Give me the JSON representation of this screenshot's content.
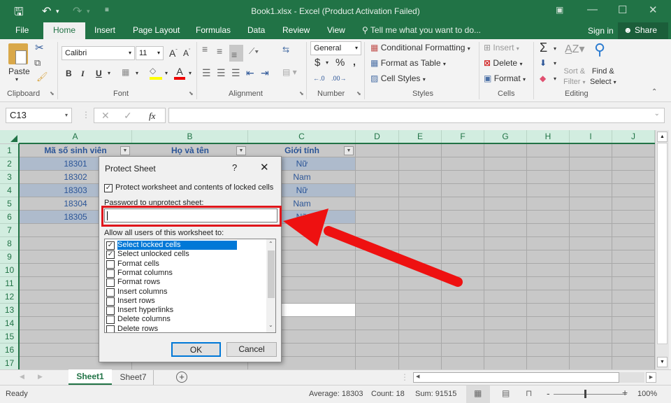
{
  "window": {
    "title": "Book1.xlsx - Excel (Product Activation Failed)"
  },
  "quick_access": {
    "save": "save-icon",
    "undo": "undo-icon",
    "redo": "redo-icon",
    "customize": "customize-icon"
  },
  "tabs": [
    "File",
    "Home",
    "Insert",
    "Page Layout",
    "Formulas",
    "Data",
    "Review",
    "View"
  ],
  "active_tab": "Home",
  "tell_me": "Tell me what you want to do...",
  "sign_in": "Sign in",
  "share": "Share",
  "ribbon": {
    "clipboard": {
      "paste": "Paste",
      "label": "Clipboard"
    },
    "font": {
      "name": "Calibri",
      "size": "11",
      "bold": "B",
      "italic": "I",
      "underline": "U",
      "label": "Font"
    },
    "alignment": {
      "label": "Alignment"
    },
    "number": {
      "format": "General",
      "currency": "$",
      "percent": "%",
      "comma": ",",
      "label": "Number"
    },
    "styles": {
      "conditional": "Conditional Formatting",
      "table": "Format as Table",
      "cell": "Cell Styles",
      "label": "Styles"
    },
    "cells": {
      "insert": "Insert",
      "delete": "Delete",
      "format": "Format",
      "label": "Cells"
    },
    "editing": {
      "sort1": "Sort &",
      "sort2": "Filter",
      "find1": "Find &",
      "find2": "Select",
      "label": "Editing"
    }
  },
  "formula_bar": {
    "name_box": "C13",
    "value": "",
    "fx": "fx"
  },
  "columns": [
    "A",
    "B",
    "C",
    "D",
    "E",
    "F",
    "G",
    "H",
    "I",
    "J"
  ],
  "rows": [
    "1",
    "2",
    "3",
    "4",
    "5",
    "6",
    "7",
    "8",
    "9",
    "10",
    "11",
    "12",
    "13",
    "14",
    "15",
    "16",
    "17"
  ],
  "table": {
    "headers": [
      "Mã số sinh viên",
      "Họ và tên",
      "Giới tính"
    ],
    "rows": [
      [
        "18301",
        "",
        "Nữ"
      ],
      [
        "18302",
        "",
        "Nam"
      ],
      [
        "18303",
        "",
        "Nữ"
      ],
      [
        "18304",
        "",
        "Nam"
      ],
      [
        "18305",
        "",
        "Nữ"
      ]
    ]
  },
  "dialog": {
    "title": "Protect Sheet",
    "help": "?",
    "protect_label": "Protect worksheet and contents of locked cells",
    "protect_checked": true,
    "password_label": "Password to unprotect sheet:",
    "password_value": "",
    "allow_label": "Allow all users of this worksheet to:",
    "permissions": [
      {
        "label": "Select locked cells",
        "checked": true,
        "selected": true
      },
      {
        "label": "Select unlocked cells",
        "checked": true
      },
      {
        "label": "Format cells",
        "checked": false
      },
      {
        "label": "Format columns",
        "checked": false
      },
      {
        "label": "Format rows",
        "checked": false
      },
      {
        "label": "Insert columns",
        "checked": false
      },
      {
        "label": "Insert rows",
        "checked": false
      },
      {
        "label": "Insert hyperlinks",
        "checked": false
      },
      {
        "label": "Delete columns",
        "checked": false
      },
      {
        "label": "Delete rows",
        "checked": false
      }
    ],
    "ok": "OK",
    "cancel": "Cancel"
  },
  "sheets": [
    "Sheet1",
    "Sheet7"
  ],
  "active_sheet": "Sheet1",
  "status": {
    "ready": "Ready",
    "average": "Average: 18303",
    "count": "Count: 18",
    "sum": "Sum: 91515",
    "zoom": "100%"
  },
  "annotation_color": "#e0161b",
  "accent": "#217346"
}
